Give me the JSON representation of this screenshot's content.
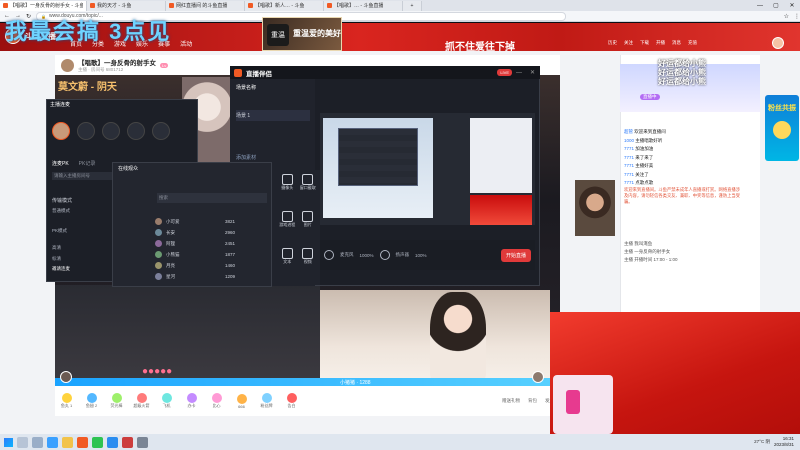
{
  "browser": {
    "tabs": [
      {
        "label": "【唱歌】一身反骨的射手女 - 斗鱼直播"
      },
      {
        "label": "我的天才 - 斗鱼"
      },
      {
        "label": "网红直播间 的斗鱼直播"
      },
      {
        "label": "【唱歌】新人… - 斗鱼"
      },
      {
        "label": "【唱歌】… - 斗鱼直播"
      }
    ],
    "url": "www.douyu.com/topic/...",
    "new_tab_label": "+"
  },
  "site": {
    "logo": "斗鱼直播",
    "nav": [
      "首页",
      "分类",
      "游戏",
      "娱乐",
      "赛事",
      "活动"
    ],
    "banner_overlay_title": "我最会搞 3点见",
    "banner_poster": "重温爱的美好",
    "banner_slogan": "抓不住爱往下掉",
    "header_icons": [
      "历史",
      "关注",
      "下载",
      "开播",
      "消息",
      "充值"
    ]
  },
  "room": {
    "title": "【唱歌】一身反骨的射手女",
    "streamer_overlay": "莫文蔚 - 阴天",
    "room_info": "主播 · 房间号 6801712",
    "follow_label": "关注",
    "follow_count": "1.2万"
  },
  "player": {
    "lyric_bar": "小猪猪 · 1288",
    "gift_items": [
      "鱼丸 1",
      "鱼翅 2",
      "荧光棒",
      "超级火箭",
      "飞机",
      "办卡",
      "比心",
      "666",
      "粉丝牌",
      "告白"
    ],
    "bottom_right": [
      "赠送礼物",
      "背包",
      "发送"
    ]
  },
  "chat": {
    "live_badge": "直播中",
    "messages": [
      {
        "user": "好运来",
        "text": "好运都给小熊"
      },
      {
        "user": "好运来",
        "text": "好运都给小熊"
      },
      {
        "user": "好运来",
        "text": "好运都给小熊"
      },
      {
        "user": "超管",
        "text": "欢迎来到直播间"
      },
      {
        "user": "1000",
        "text": "主播唱歌好听"
      },
      {
        "user": "7771",
        "text": "加油加油"
      },
      {
        "user": "7771",
        "text": "来了来了"
      },
      {
        "user": "7771",
        "text": "主播好美"
      },
      {
        "user": "7771",
        "text": "关注了"
      },
      {
        "user": "7771",
        "text": "点歌点歌"
      }
    ],
    "notice": "欢迎来到直播间。斗鱼严禁未成年人直播或打赏。网络直播涉及内容，请勿轻信各类交友、兼职、中奖等信息，谨防上当受骗。",
    "bottom_msgs": [
      {
        "user": "主播",
        "text": "我叫淹鱼"
      },
      {
        "user": "主播",
        "text": "一身反骨的射手女"
      },
      {
        "user": "主播",
        "text": "开播时间 17:00 - 1:00"
      }
    ],
    "input_placeholder": "这里输入聊天内容",
    "send_label": "发送",
    "side_ad": "粉丝共振"
  },
  "toolbox": {
    "title": "直播伴侣",
    "scene_label": "场景名称",
    "scene_1": "场景 1",
    "list_header": "添加素材",
    "items": [
      "摄像头",
      "窗口截取",
      "游戏进程",
      "图片",
      "文本",
      "视频"
    ],
    "search_placeholder": "搜索",
    "bottom_fields": [
      "声音",
      "1000%",
      "100%"
    ],
    "start_button": "开始直播",
    "mic_label": "麦克风",
    "speaker_label": "扬声器"
  },
  "pk": {
    "title": "主播连麦",
    "tab_1": "连麦PK",
    "tab_2": "PK记录",
    "room_mode": "传输模式",
    "hint": "请输入主播房间号",
    "rows": [
      "普通模式",
      "PK模式",
      "高清",
      "标清"
    ],
    "invite": "邀请连麦"
  },
  "list_panel": {
    "title": "在线观众",
    "users": [
      {
        "name": "小可爱",
        "score": "3821"
      },
      {
        "name": "长安",
        "score": "2960"
      },
      {
        "name": "阿狸",
        "score": "2451"
      },
      {
        "name": "小熊猫",
        "score": "1877"
      },
      {
        "name": "月亮",
        "score": "1460"
      },
      {
        "name": "星河",
        "score": "1209"
      }
    ]
  },
  "taskbar": {
    "time": "16:31",
    "date": "2023/8/31",
    "weather": "27°C 阴"
  },
  "colors": {
    "douyu_orange": "#f15a24",
    "douyu_red": "#d9251f",
    "accent_blue": "#2d7bfa"
  }
}
